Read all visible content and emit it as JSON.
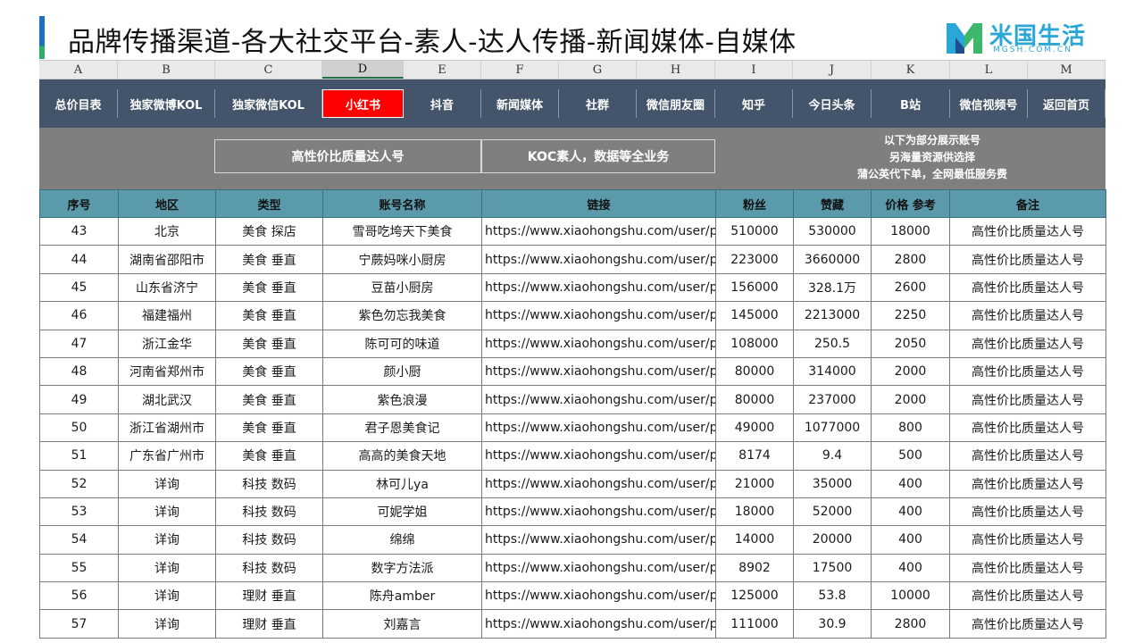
{
  "title": "品牌传播渠道-各大社交平台-素人-达人传播-新闻媒体-自媒体",
  "logo": {
    "name": "米国生活",
    "sub": "MGSH.COM.CN",
    "colors": {
      "blue": "#2aa7d6",
      "green": "#3db86a",
      "navy": "#1f4f8f"
    }
  },
  "columns": [
    "A",
    "B",
    "C",
    "D",
    "E",
    "F",
    "G",
    "H",
    "I",
    "J",
    "K",
    "L",
    "M"
  ],
  "selected_column": "D",
  "nav": [
    {
      "label": "总价目表"
    },
    {
      "label": "独家微博KOL"
    },
    {
      "label": "独家微信KOL"
    },
    {
      "label": "小红书",
      "active": true
    },
    {
      "label": "抖音"
    },
    {
      "label": "新闻媒体"
    },
    {
      "label": "社群"
    },
    {
      "label": "微信朋友圈"
    },
    {
      "label": "知乎"
    },
    {
      "label": "今日头条"
    },
    {
      "label": "B站"
    },
    {
      "label": "微信视频号"
    },
    {
      "label": "返回首页"
    }
  ],
  "tags": [
    "高性价比质量达人号",
    "KOC素人，数据等全业务"
  ],
  "note_lines": [
    "以下为部分展示账号",
    "另海量资源供选择",
    "蒲公英代下单，全网最低服务费"
  ],
  "table": {
    "headers": [
      "序号",
      "地区",
      "类型",
      "账号名称",
      "链接",
      "粉丝",
      "赞藏",
      "价格 参考",
      "备注"
    ],
    "rows": [
      [
        "43",
        "北京",
        "美食 探店",
        "雪哥吃垮天下美食",
        "https://www.xiaohongshu.com/user/p",
        "510000",
        "530000",
        "18000",
        "高性价比质量达人号"
      ],
      [
        "44",
        "湖南省邵阳市",
        "美食 垂直",
        "宁蕨妈咪小厨房",
        "https://www.xiaohongshu.com/user/p",
        "223000",
        "3660000",
        "2800",
        "高性价比质量达人号"
      ],
      [
        "45",
        "山东省济宁",
        "美食 垂直",
        "豆苗小厨房",
        "https://www.xiaohongshu.com/user/p",
        "156000",
        "328.1万",
        "2600",
        "高性价比质量达人号"
      ],
      [
        "46",
        "福建福州",
        "美食 垂直",
        "紫色勿忘我美食",
        "https://www.xiaohongshu.com/user/p",
        "145000",
        "2213000",
        "2250",
        "高性价比质量达人号"
      ],
      [
        "47",
        "浙江金华",
        "美食 垂直",
        "陈可可的味道",
        "https://www.xiaohongshu.com/user/p",
        "108000",
        "250.5",
        "2050",
        "高性价比质量达人号"
      ],
      [
        "48",
        "河南省郑州市",
        "美食 垂直",
        "颜小厨",
        "https://www.xiaohongshu.com/user/p",
        "80000",
        "314000",
        "2000",
        "高性价比质量达人号"
      ],
      [
        "49",
        "湖北武汉",
        "美食 垂直",
        "紫色浪漫",
        "https://www.xiaohongshu.com/user/p",
        "80000",
        "237000",
        "2000",
        "高性价比质量达人号"
      ],
      [
        "50",
        "浙江省湖州市",
        "美食 垂直",
        "君子恩美食记",
        "https://www.xiaohongshu.com/user/p",
        "49000",
        "1077000",
        "800",
        "高性价比质量达人号"
      ],
      [
        "51",
        "广东省广州市",
        "美食 垂直",
        "高高的美食天地",
        "https://www.xiaohongshu.com/user/p",
        "8174",
        "9.4",
        "500",
        "高性价比质量达人号"
      ],
      [
        "52",
        "详询",
        "科技 数码",
        "林可儿ya",
        "https://www.xiaohongshu.com/user/p",
        "21000",
        "35000",
        "400",
        "高性价比质量达人号"
      ],
      [
        "53",
        "详询",
        "科技 数码",
        "可妮学姐",
        "https://www.xiaohongshu.com/user/p",
        "18000",
        "52000",
        "400",
        "高性价比质量达人号"
      ],
      [
        "54",
        "详询",
        "科技 数码",
        "绵绵",
        "https://www.xiaohongshu.com/user/p",
        "14000",
        "20000",
        "400",
        "高性价比质量达人号"
      ],
      [
        "55",
        "详询",
        "科技 数码",
        "数字方法派",
        "https://www.xiaohongshu.com/user/p",
        "8902",
        "17500",
        "400",
        "高性价比质量达人号"
      ],
      [
        "56",
        "详询",
        "理财 垂直",
        "陈舟amber",
        "https://www.xiaohongshu.com/user/p",
        "125000",
        "53.8",
        "10000",
        "高性价比质量达人号"
      ],
      [
        "57",
        "详询",
        "理财 垂直",
        "刘嘉言",
        "https://www.xiaohongshu.com/user/p",
        "111000",
        "30.9",
        "2800",
        "高性价比质量达人号"
      ]
    ]
  }
}
